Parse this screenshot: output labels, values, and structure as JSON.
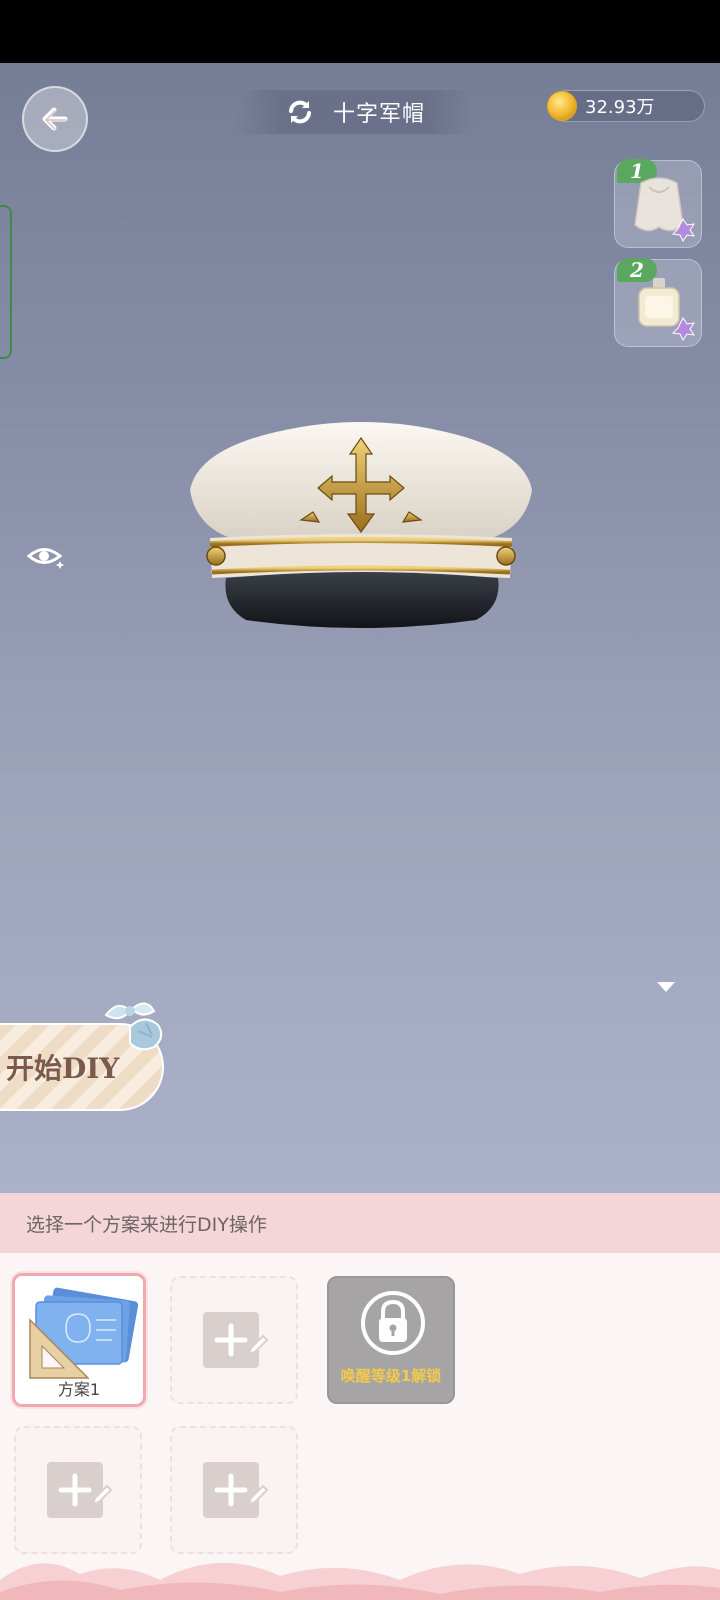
{
  "header": {
    "title": "十字军帽",
    "currency": "32.93万"
  },
  "side_slots": [
    {
      "badge": "1",
      "item": "white-cape"
    },
    {
      "badge": "2",
      "item": "perfume-bottle"
    }
  ],
  "diy": {
    "start_label": "开始DIY"
  },
  "panel": {
    "hint": "选择一个方案来进行DIY操作",
    "plans": [
      {
        "state": "selected",
        "label": "方案1"
      },
      {
        "state": "empty"
      },
      {
        "state": "locked",
        "lock_text": "唤醒等级1解锁"
      },
      {
        "state": "empty"
      },
      {
        "state": "empty"
      }
    ]
  },
  "colors": {
    "stage_top": "#767d97",
    "stage_bottom": "#aab1c9",
    "panel_header": "#f5d6d8",
    "badge_green": "#5aa860",
    "lock_text": "#f2c94c",
    "selected_border": "#f1a9ae"
  },
  "icons": [
    "back-arrow-icon",
    "refresh-icon",
    "coin-icon",
    "eye-icon",
    "dropdown-arrow-icon",
    "lock-icon",
    "add-plan-icon"
  ]
}
